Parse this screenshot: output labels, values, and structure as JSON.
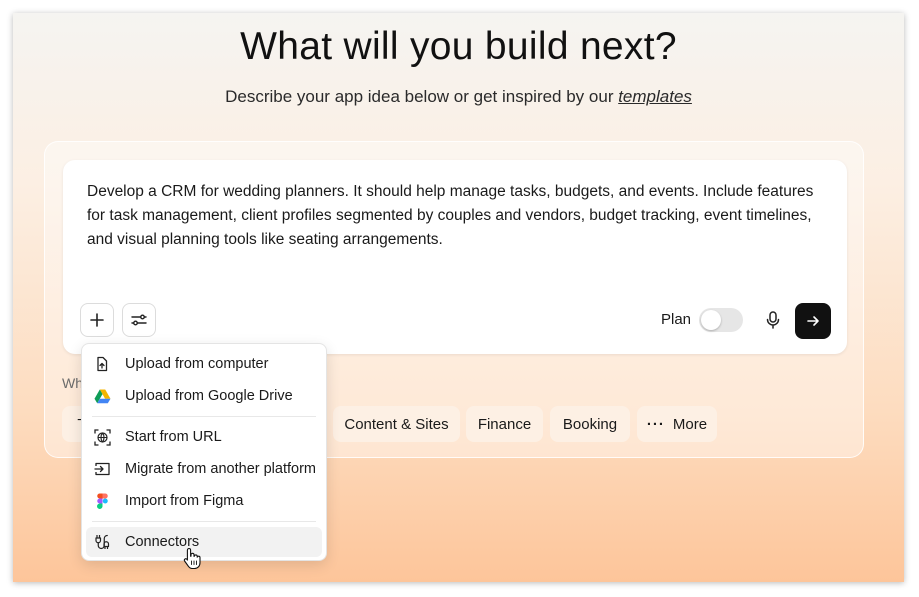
{
  "header": {
    "title": "What will you build next?",
    "subtitle_prefix": "Describe your app idea below or get inspired by our ",
    "subtitle_link": "templates"
  },
  "prompt": {
    "text": "Develop a CRM for wedding planners. It should help manage tasks, budgets, and events. Include features for task management, client profiles segmented by couples and vendors, budget tracking, event timelines, and visual planning tools like seating arrangements."
  },
  "toolbar": {
    "plus_icon": "plus-icon",
    "settings_icon": "sliders-icon",
    "plan_label": "Plan",
    "plan_enabled": false,
    "mic_icon": "microphone-icon",
    "send_icon": "arrow-right-icon"
  },
  "suggestions": {
    "label_partial": "Wh",
    "chips": [
      {
        "label": "T"
      },
      {
        "label": "Content & Sites"
      },
      {
        "label": "Finance"
      },
      {
        "label": "Booking"
      },
      {
        "label": "More"
      }
    ]
  },
  "menu": {
    "items": [
      {
        "label": "Upload from computer",
        "icon": "upload-file-icon"
      },
      {
        "label": "Upload from Google Drive",
        "icon": "google-drive-icon"
      },
      {
        "label": "Start from URL",
        "icon": "globe-icon"
      },
      {
        "label": "Migrate from another platform",
        "icon": "import-arrow-icon"
      },
      {
        "label": "Import from Figma",
        "icon": "figma-icon"
      },
      {
        "label": "Connectors",
        "icon": "connectors-icon"
      }
    ],
    "hovered_item": "Connectors"
  },
  "colors": {
    "send_button": "#111111",
    "gradient_top": "#f5f4f1",
    "gradient_bottom": "#fdc59a",
    "chip_background": "#fdf0e4"
  }
}
